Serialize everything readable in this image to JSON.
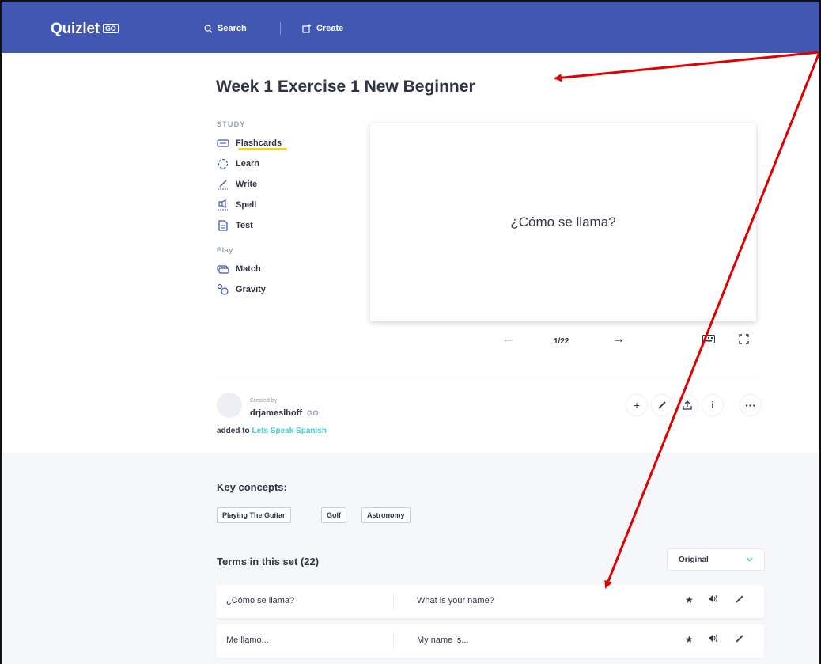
{
  "header": {
    "logo": "Quizlet",
    "logo_badge": "GO",
    "search_label": "Search",
    "create_label": "Create"
  },
  "set": {
    "title": "Week 1 Exercise 1 New Beginner"
  },
  "study": {
    "section_label": "STUDY",
    "modes": [
      {
        "label": "Flashcards",
        "icon": "flashcards-icon"
      },
      {
        "label": "Learn",
        "icon": "learn-icon"
      },
      {
        "label": "Write",
        "icon": "write-icon"
      },
      {
        "label": "Spell",
        "icon": "spell-icon"
      },
      {
        "label": "Test",
        "icon": "test-icon"
      }
    ]
  },
  "play": {
    "section_label": "Play",
    "modes": [
      {
        "label": "Match",
        "icon": "match-icon"
      },
      {
        "label": "Gravity",
        "icon": "gravity-icon"
      }
    ]
  },
  "flashcard": {
    "term": "¿Cómo se llama?",
    "counter": "1/22"
  },
  "creator": {
    "created_by_label": "Created by",
    "name": "drjameslhoff",
    "badge": "GO",
    "added_to_prefix": "added to",
    "folder": "Lets Speak Spanish"
  },
  "key_concepts": {
    "title": "Key concepts:",
    "chips": [
      "Playing The Guitar",
      "Golf",
      "Astronomy"
    ]
  },
  "terms": {
    "title": "Terms in this set (22)",
    "sort_value": "Original",
    "rows": [
      {
        "term": "¿Cómo se llama?",
        "definition": "What is your name?"
      },
      {
        "term": "Me llamo...",
        "definition": "My name is..."
      }
    ]
  },
  "colors": {
    "header_bg": "#4257b2",
    "accent_underline": "#ffcd1f",
    "link": "#3ccfcf",
    "annotation": "#e00000"
  }
}
